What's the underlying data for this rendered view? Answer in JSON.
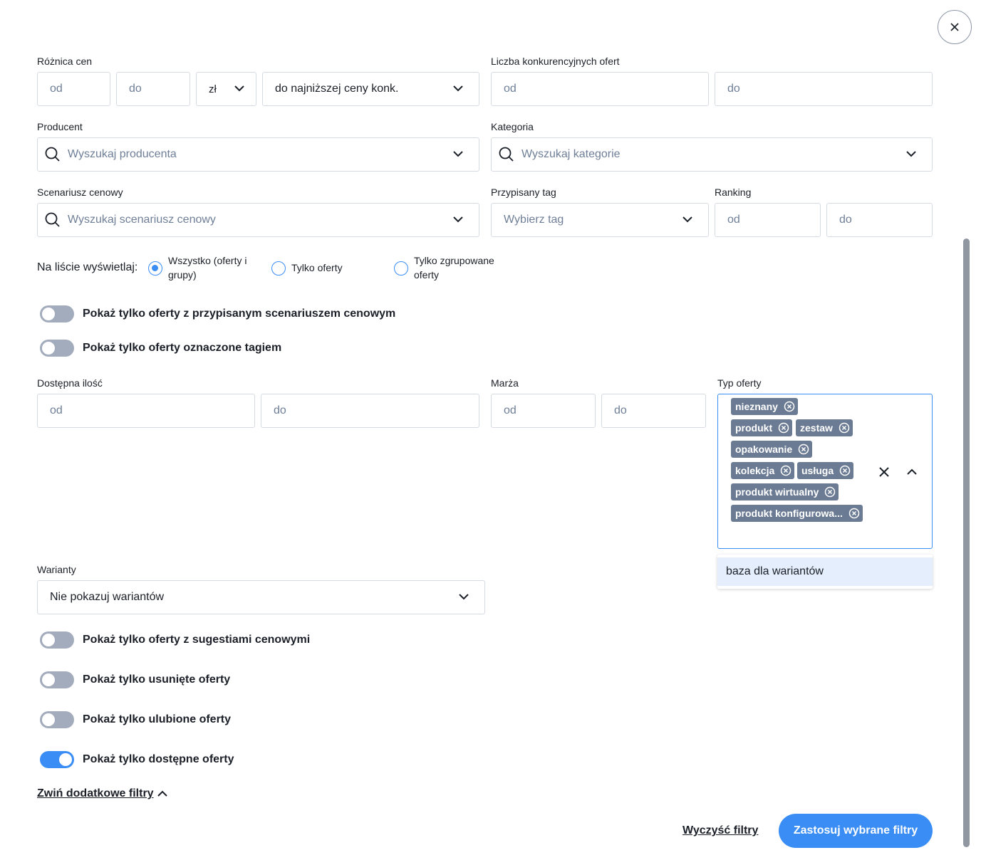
{
  "price_diff": {
    "label": "Różnica cen",
    "from_placeholder": "od",
    "to_placeholder": "do",
    "currency": "zł",
    "mode": "do najniższej ceny konk."
  },
  "competitor_offers": {
    "label": "Liczba konkurencyjnych ofert",
    "from_placeholder": "od",
    "to_placeholder": "do"
  },
  "producer": {
    "label": "Producent",
    "placeholder": "Wyszukaj producenta"
  },
  "category": {
    "label": "Kategoria",
    "placeholder": "Wyszukaj kategorie"
  },
  "price_scenario": {
    "label": "Scenariusz cenowy",
    "placeholder": "Wyszukaj scenariusz cenowy"
  },
  "tag": {
    "label": "Przypisany tag",
    "placeholder": "Wybierz tag"
  },
  "ranking": {
    "label": "Ranking",
    "from_placeholder": "od",
    "to_placeholder": "do"
  },
  "display": {
    "label": "Na liście wyświetlaj:",
    "options": [
      {
        "line1": "Wszystko (oferty i",
        "line2": "grupy)",
        "selected": true
      },
      {
        "line1": "Tylko oferty",
        "line2": "",
        "selected": false
      },
      {
        "line1": "Tylko zgrupowane",
        "line2": "oferty",
        "selected": false
      }
    ]
  },
  "toggles_top": [
    {
      "label": "Pokaż tylko oferty z przypisanym scenariuszem cenowym",
      "on": false
    },
    {
      "label": "Pokaż tylko oferty oznaczone tagiem",
      "on": false
    }
  ],
  "quantity": {
    "label": "Dostępna ilość",
    "from_placeholder": "od",
    "to_placeholder": "do"
  },
  "margin": {
    "label": "Marża",
    "from_placeholder": "od",
    "to_placeholder": "do"
  },
  "offer_type": {
    "label": "Typ oferty",
    "chips": [
      "nieznany",
      "produkt",
      "zestaw",
      "opakowanie",
      "kolekcja",
      "usługa",
      "produkt wirtualny",
      "produkt konfigurowa..."
    ],
    "dropdown_option": "baza dla wariantów"
  },
  "variants": {
    "label": "Warianty",
    "value": "Nie pokazuj wariantów"
  },
  "toggles_bottom": [
    {
      "label": "Pokaż tylko oferty z sugestiami cenowymi",
      "on": false
    },
    {
      "label": "Pokaż tylko usunięte oferty",
      "on": false
    },
    {
      "label": "Pokaż tylko ulubione oferty",
      "on": false
    },
    {
      "label": "Pokaż tylko dostępne oferty",
      "on": true
    }
  ],
  "collapse_link": "Zwiń dodatkowe filtry",
  "clear_link": "Wyczyść filtry",
  "apply_button": "Zastosuj wybrane filtry",
  "colors": {
    "accent": "#3a8df5",
    "chip": "#6b7b93",
    "toggle_off": "#a2acbc"
  }
}
